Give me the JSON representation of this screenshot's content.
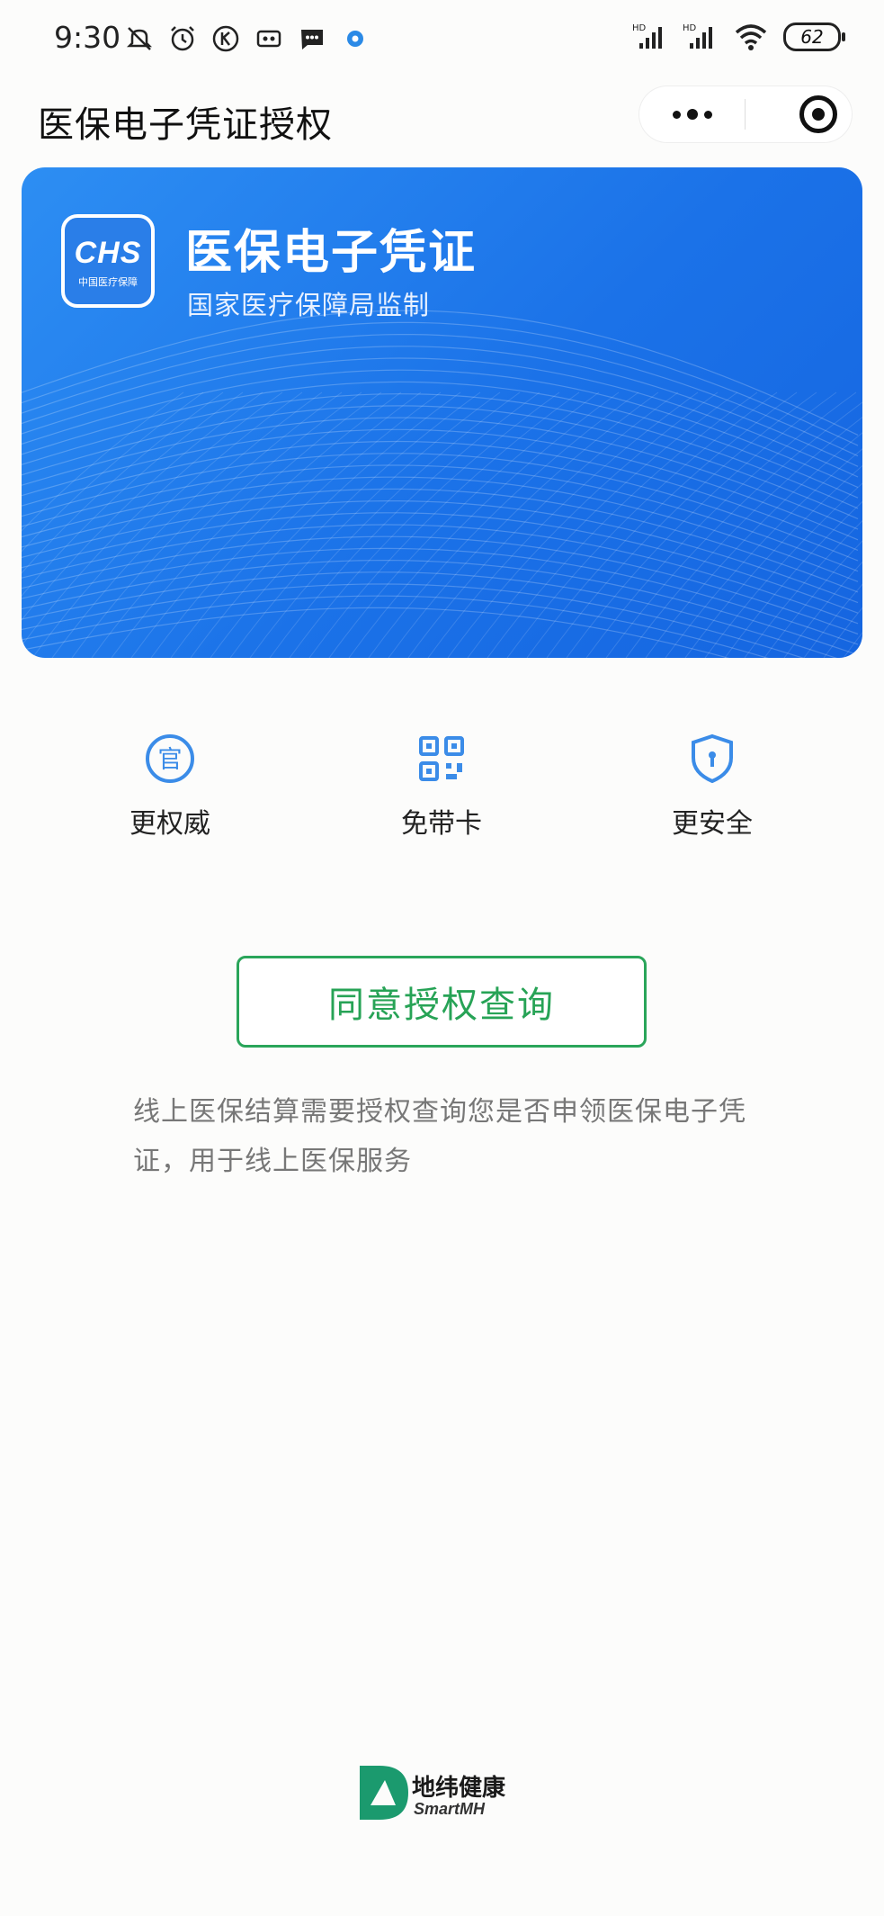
{
  "status_bar": {
    "time": "9:30",
    "battery": "62",
    "left_icons": [
      "mute-icon",
      "alarm-icon",
      "k-icon",
      "voicemail-icon",
      "message-icon",
      "app-dot-icon"
    ],
    "right_icons": [
      "signal-hd-icon",
      "signal-hd-icon",
      "wifi-icon",
      "battery-icon"
    ]
  },
  "nav": {
    "title": "医保电子凭证授权"
  },
  "card": {
    "logo_text": "CHS",
    "logo_sub": "中国医疗保障",
    "title": "医保电子凭证",
    "subtitle": "国家医疗保障局监制",
    "colors": {
      "start": "#2d8ef3",
      "end": "#1565e0"
    }
  },
  "features": [
    {
      "icon": "official-seal-icon",
      "label": "更权威"
    },
    {
      "icon": "qr-code-icon",
      "label": "免带卡"
    },
    {
      "icon": "shield-lock-icon",
      "label": "更安全"
    }
  ],
  "actions": {
    "agree_label": "同意授权查询",
    "accent": "#27a356"
  },
  "description": "线上医保结算需要授权查询您是否申领医保电子凭证，用于线上医保服务",
  "footer": {
    "brand_name": "地纬健康",
    "brand_sub": "SmartMH"
  }
}
